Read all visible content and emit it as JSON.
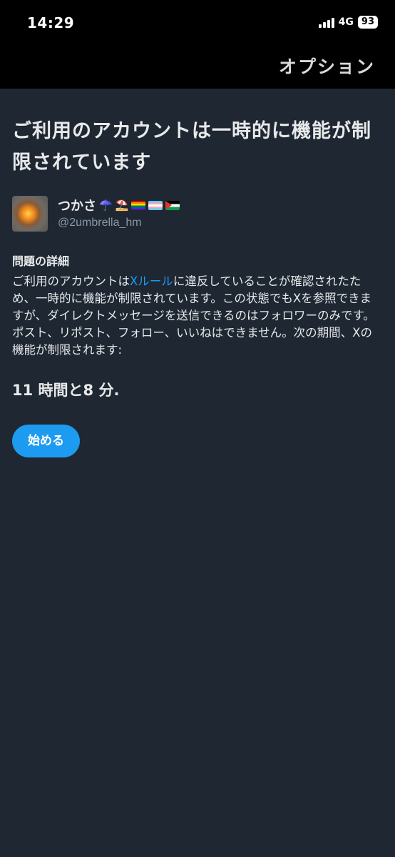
{
  "status_bar": {
    "time": "14:29",
    "network": "4G",
    "battery": "93"
  },
  "header": {
    "options_label": "オプション"
  },
  "notice": {
    "title": "ご利用のアカウントは一時的に機能が制限されています"
  },
  "user": {
    "name": "つかさ",
    "emojis": [
      "umbrella",
      "beach-umbrella",
      "rainbow-flag",
      "trans-flag",
      "palestine-flag"
    ],
    "umbrella_emoji": "☂️",
    "beach_umbrella_emoji": "⛱️",
    "handle": "@2umbrella_hm"
  },
  "details": {
    "heading": "問題の詳細",
    "text_before_link": "ご利用のアカウントは",
    "link_text": "Xルール",
    "text_after_link": "に違反していることが確認されたため、一時的に機能が制限されています。この状態でもXを参照できますが、ダイレクトメッセージを送信できるのはフォロワーのみです。ポスト、リポスト、フォロー、いいねはできません。次の期間、Xの機能が制限されます:"
  },
  "timer": {
    "text": "11 時間と8 分."
  },
  "actions": {
    "start_label": "始める"
  },
  "colors": {
    "background": "#1e2732",
    "header_background": "#000000",
    "accent": "#1d9bf0",
    "text": "#e7e9ea",
    "muted": "#8b98a5"
  }
}
